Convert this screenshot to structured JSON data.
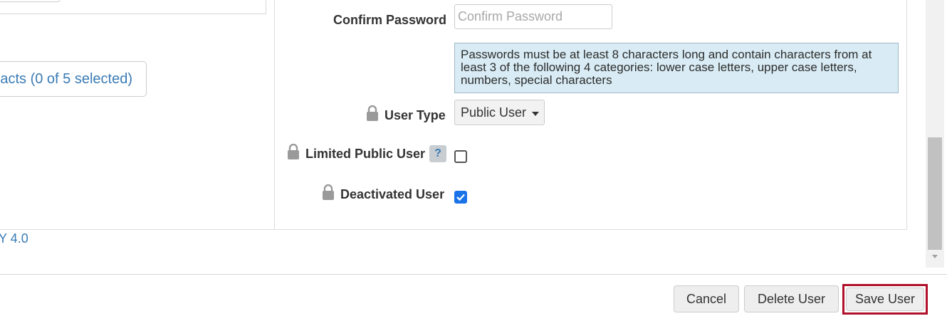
{
  "left": {
    "contacts_button_label": "acts (0 of 5 selected)",
    "license_text": "Y 4.0"
  },
  "form": {
    "confirm_password": {
      "label": "Confirm Password",
      "placeholder": "Confirm Password",
      "value": ""
    },
    "password_hint": "Passwords must be at least 8 characters long and contain characters from at least 3 of the following 4 categories: lower case letters, upper case letters, numbers, special characters",
    "user_type": {
      "label": "User Type",
      "selected": "Public User"
    },
    "limited_public_user": {
      "label": "Limited Public User",
      "help": "?",
      "checked": false
    },
    "deactivated_user": {
      "label": "Deactivated User",
      "checked": true
    }
  },
  "icons": {
    "lock": "lock-icon",
    "caret": "caret-down-icon",
    "check": "checkmark-icon"
  },
  "colors": {
    "link": "#3a7bb5",
    "info_bg": "#d9ecf5",
    "checkbox_checked": "#1a73e8",
    "highlight": "#b0102a"
  },
  "footer": {
    "cancel_label": "Cancel",
    "delete_label": "Delete User",
    "save_label": "Save User"
  }
}
